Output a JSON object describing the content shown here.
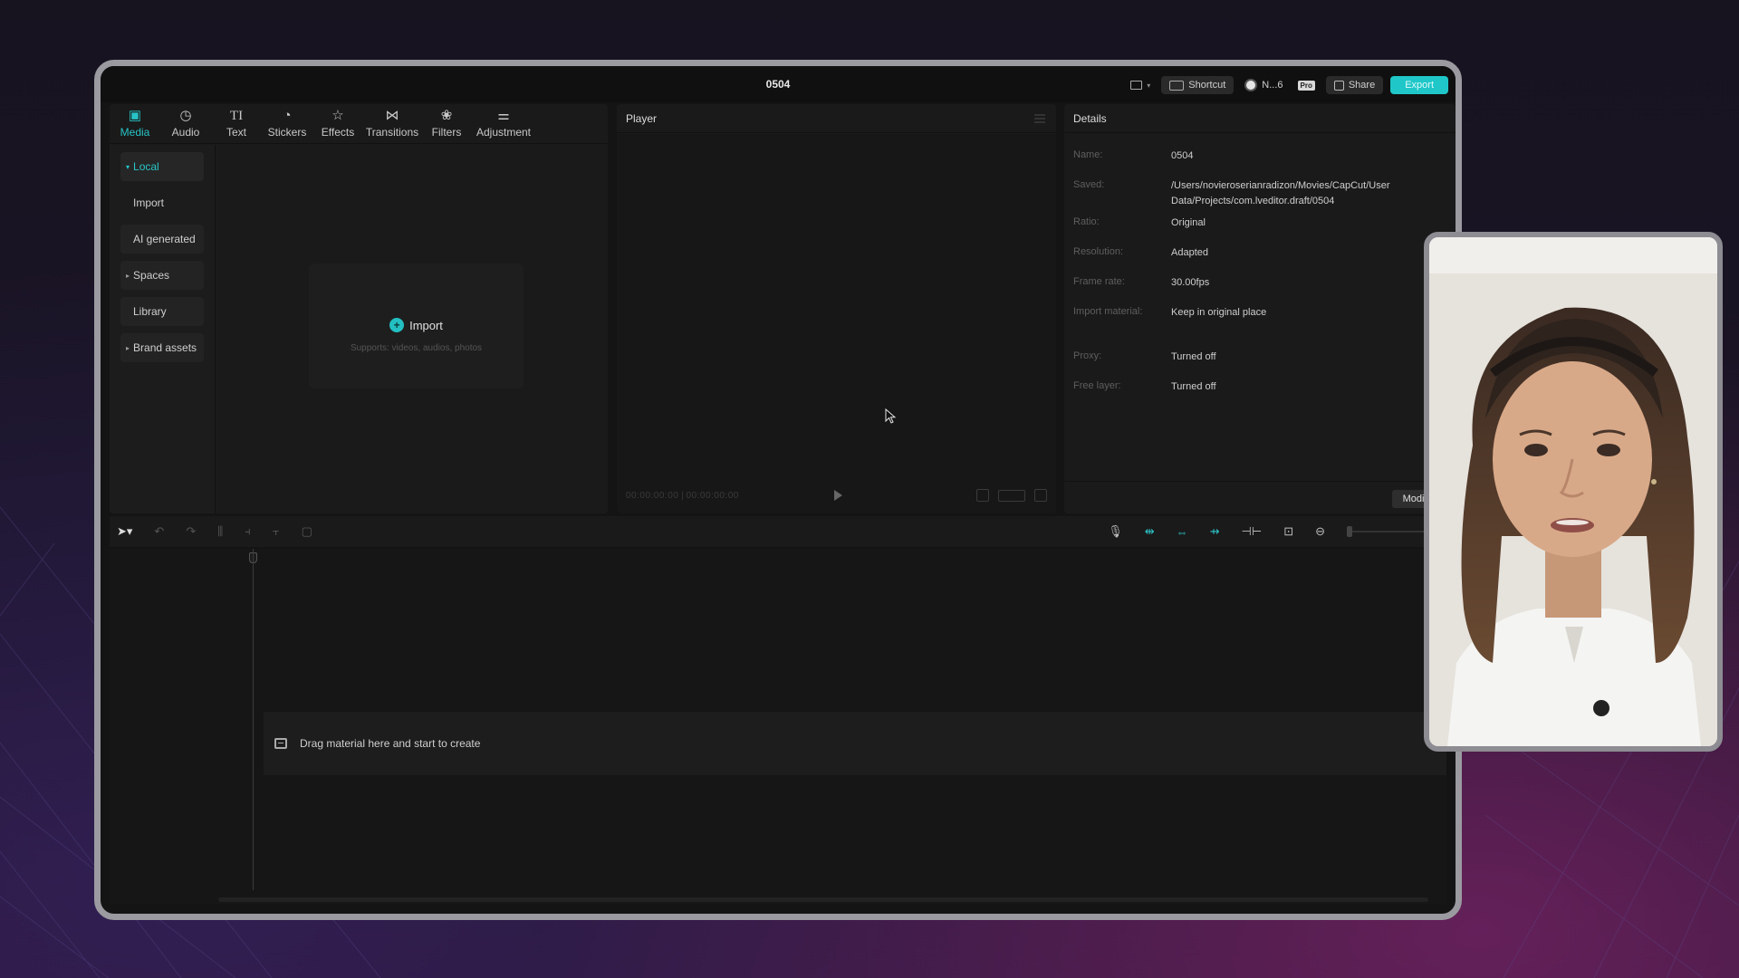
{
  "window": {
    "title": "0504"
  },
  "titlebar": {
    "shortcut_label": "Shortcut",
    "user_label": "N...6",
    "pro_badge": "Pro",
    "share_label": "Share",
    "export_label": "Export"
  },
  "media_tabs": [
    {
      "label": "Media",
      "icon": "media-icon",
      "active": true
    },
    {
      "label": "Audio",
      "icon": "audio-icon"
    },
    {
      "label": "Text",
      "icon": "text-icon"
    },
    {
      "label": "Stickers",
      "icon": "stickers-icon"
    },
    {
      "label": "Effects",
      "icon": "effects-icon"
    },
    {
      "label": "Transitions",
      "icon": "transitions-icon"
    },
    {
      "label": "Filters",
      "icon": "filters-icon"
    },
    {
      "label": "Adjustment",
      "icon": "adjustment-icon"
    }
  ],
  "sidebar": {
    "items": [
      {
        "label": "Local"
      },
      {
        "label": "Import"
      },
      {
        "label": "AI generated"
      },
      {
        "label": "Spaces"
      },
      {
        "label": "Library"
      },
      {
        "label": "Brand assets"
      }
    ]
  },
  "import_card": {
    "title": "Import",
    "subtitle": "Supports: videos, audios, photos"
  },
  "player": {
    "title": "Player",
    "timecode_current": "00:00:00:00",
    "timecode_total": "00:00:00:00",
    "ratio_label": "Ratio"
  },
  "details": {
    "title": "Details",
    "rows": [
      {
        "label": "Name:",
        "value": "0504"
      },
      {
        "label": "Saved:",
        "value": "/Users/novieroserianradizon/Movies/CapCut/User Data/Projects/com.lveditor.draft/0504"
      },
      {
        "label": "Ratio:",
        "value": "Original"
      },
      {
        "label": "Resolution:",
        "value": "Adapted"
      },
      {
        "label": "Frame rate:",
        "value": "30.00fps"
      },
      {
        "label": "Import material:",
        "value": "Keep in original place"
      },
      {
        "label": "Proxy:",
        "value": "Turned off"
      },
      {
        "label": "Free layer:",
        "value": "Turned off"
      }
    ],
    "modify_label": "Modify"
  },
  "timeline": {
    "drop_hint": "Drag material here and start to create"
  },
  "colors": {
    "accent": "#27c3c6",
    "panel": "#1a1a1a",
    "background": "#141414"
  }
}
